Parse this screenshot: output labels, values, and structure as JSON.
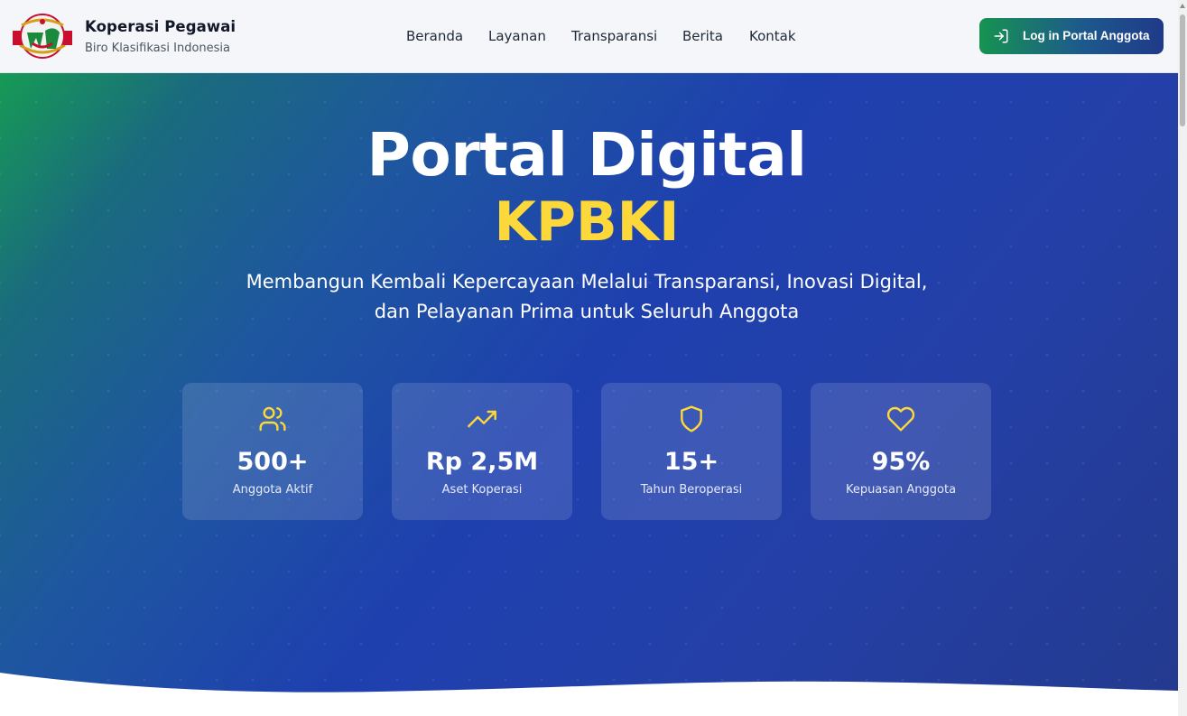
{
  "header": {
    "brand_title": "Koperasi Pegawai",
    "brand_subtitle": "Biro Klasifikasi Indonesia",
    "logo_icon": "koperasi-logo",
    "nav": [
      {
        "label": "Beranda"
      },
      {
        "label": "Layanan"
      },
      {
        "label": "Transparansi"
      },
      {
        "label": "Berita"
      },
      {
        "label": "Kontak"
      }
    ],
    "login_label": "Log in Portal Anggota",
    "login_icon": "log-in-icon"
  },
  "hero": {
    "title_line1": "Portal Digital",
    "title_line2": "KPBKI",
    "subtitle_line1": "Membangun Kembali Kepercayaan Melalui Transparansi, Inovasi Digital,",
    "subtitle_line2": "dan Pelayanan Prima untuk Seluruh Anggota",
    "stats": [
      {
        "icon": "users-icon",
        "value": "500+",
        "label": "Anggota Aktif"
      },
      {
        "icon": "trending-up-icon",
        "value": "Rp 2,5M",
        "label": "Aset Koperasi"
      },
      {
        "icon": "shield-icon",
        "value": "15+",
        "label": "Tahun Beroperasi"
      },
      {
        "icon": "heart-icon",
        "value": "95%",
        "label": "Kepuasan Anggota"
      }
    ]
  },
  "colors": {
    "accent_yellow": "#fcd83a",
    "hero_blue": "#1e40af",
    "hero_green": "#169a55",
    "button_green": "#169350",
    "button_blue": "#1f3a8a"
  }
}
